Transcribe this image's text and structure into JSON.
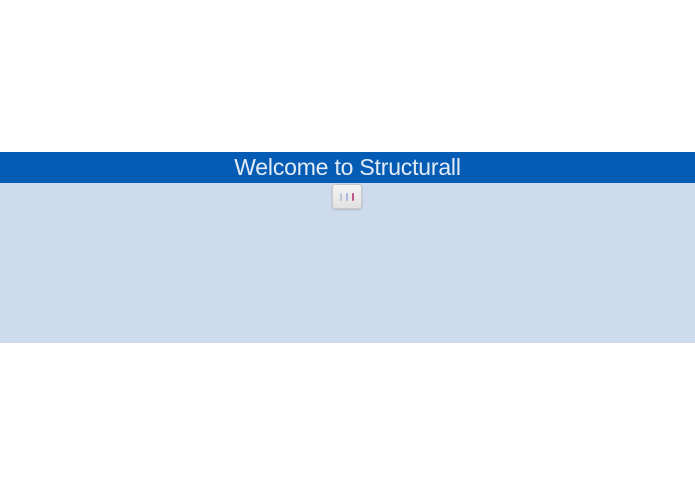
{
  "banner": {
    "title": "Welcome to Structurall"
  },
  "colors": {
    "banner_background": "#055cb5",
    "banner_text": "#e4ecf6",
    "panel_background": "#cddbed",
    "page_background": "#ffffff"
  },
  "loader": {
    "icon": "loading-bars-icon"
  }
}
